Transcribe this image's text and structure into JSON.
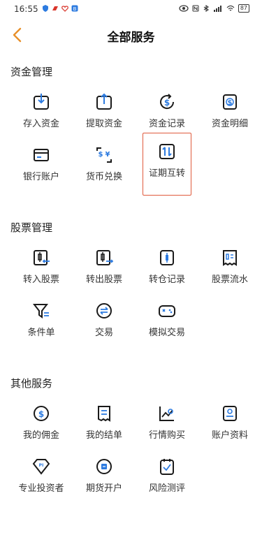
{
  "status": {
    "time": "16:55",
    "battery": "87"
  },
  "nav": {
    "title": "全部服务"
  },
  "sections": {
    "funds": {
      "title": "资金管理",
      "items": [
        "存入资金",
        "提取资金",
        "资金记录",
        "资金明细",
        "银行账户",
        "货币兑换",
        "证期互转"
      ]
    },
    "stocks": {
      "title": "股票管理",
      "items": [
        "转入股票",
        "转出股票",
        "转仓记录",
        "股票流水",
        "条件单",
        "交易",
        "模拟交易"
      ]
    },
    "other": {
      "title": "其他服务",
      "items": [
        "我的佣金",
        "我的结单",
        "行情购买",
        "账户资料",
        "专业投资者",
        "期货开户",
        "风险测评"
      ]
    }
  },
  "colors": {
    "accent": "#e8902b",
    "icon": "#1a1a1a",
    "highlight": "#e05a3c"
  }
}
